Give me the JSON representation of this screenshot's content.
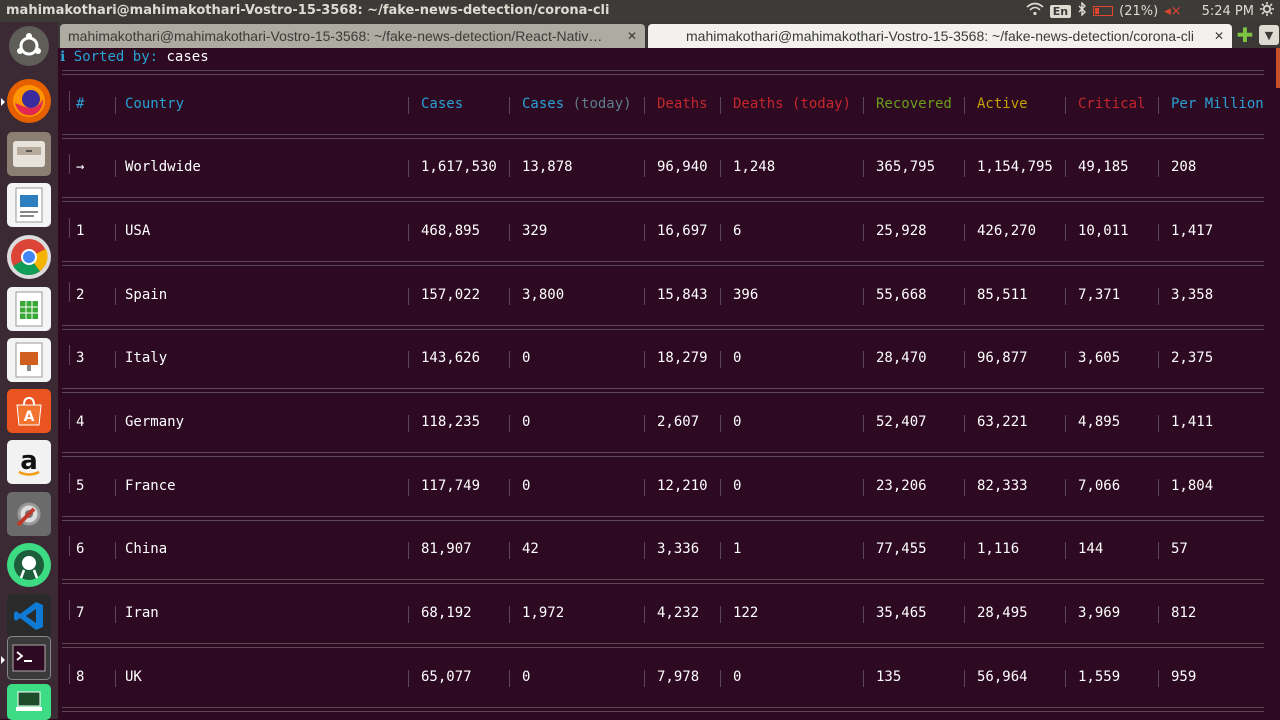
{
  "topbar": {
    "title": "mahimakothari@mahimakothari-Vostro-15-3568: ~/fake-news-detection/corona-cli",
    "keyboard": "En",
    "battery": "(21%)",
    "time": "5:24 PM"
  },
  "launcher": {
    "apps": [
      "ubuntu-dash-icon",
      "firefox-icon",
      "files-icon",
      "writer-icon",
      "chrome-icon",
      "calc-icon",
      "impress-icon",
      "software-center-icon",
      "amazon-icon",
      "system-settings-icon",
      "android-studio-icon",
      "vscode-icon",
      "terminal-icon",
      "vm-icon"
    ]
  },
  "tabs": [
    {
      "label": "mahimakothari@mahimakothari-Vostro-15-3568: ~/fake-news-detection/React-Nativ…",
      "active": false
    },
    {
      "label": "mahimakothari@mahimakothari-Vostro-15-3568: ~/fake-news-detection/corona-cli",
      "active": true
    }
  ],
  "terminal": {
    "info_icon": "ℹ",
    "sorted_label": "Sorted by:",
    "sorted_value": "cases",
    "headers": {
      "num": "#",
      "country": "Country",
      "cases": "Cases",
      "cases_today": "Cases",
      "cases_today_suffix": "(today)",
      "deaths": "Deaths",
      "deaths_today": "Deaths (today)",
      "recovered": "Recovered",
      "active": "Active",
      "critical": "Critical",
      "per_million": "Per Million"
    },
    "rows": [
      {
        "num": "→",
        "country": "Worldwide",
        "cases": "1,617,530",
        "cases_today": "13,878",
        "deaths": "96,940",
        "deaths_today": "1,248",
        "recovered": "365,795",
        "active": "1,154,795",
        "critical": "49,185",
        "per_million": "208"
      },
      {
        "num": "1",
        "country": "USA",
        "cases": "468,895",
        "cases_today": "329",
        "deaths": "16,697",
        "deaths_today": "6",
        "recovered": "25,928",
        "active": "426,270",
        "critical": "10,011",
        "per_million": "1,417"
      },
      {
        "num": "2",
        "country": "Spain",
        "cases": "157,022",
        "cases_today": "3,800",
        "deaths": "15,843",
        "deaths_today": "396",
        "recovered": "55,668",
        "active": "85,511",
        "critical": "7,371",
        "per_million": "3,358"
      },
      {
        "num": "3",
        "country": "Italy",
        "cases": "143,626",
        "cases_today": "0",
        "deaths": "18,279",
        "deaths_today": "0",
        "recovered": "28,470",
        "active": "96,877",
        "critical": "3,605",
        "per_million": "2,375"
      },
      {
        "num": "4",
        "country": "Germany",
        "cases": "118,235",
        "cases_today": "0",
        "deaths": "2,607",
        "deaths_today": "0",
        "recovered": "52,407",
        "active": "63,221",
        "critical": "4,895",
        "per_million": "1,411"
      },
      {
        "num": "5",
        "country": "France",
        "cases": "117,749",
        "cases_today": "0",
        "deaths": "12,210",
        "deaths_today": "0",
        "recovered": "23,206",
        "active": "82,333",
        "critical": "7,066",
        "per_million": "1,804"
      },
      {
        "num": "6",
        "country": "China",
        "cases": "81,907",
        "cases_today": "42",
        "deaths": "3,336",
        "deaths_today": "1",
        "recovered": "77,455",
        "active": "1,116",
        "critical": "144",
        "per_million": "57"
      },
      {
        "num": "7",
        "country": "Iran",
        "cases": "68,192",
        "cases_today": "1,972",
        "deaths": "4,232",
        "deaths_today": "122",
        "recovered": "35,465",
        "active": "28,495",
        "critical": "3,969",
        "per_million": "812"
      },
      {
        "num": "8",
        "country": "UK",
        "cases": "65,077",
        "cases_today": "0",
        "deaths": "7,978",
        "deaths_today": "0",
        "recovered": "135",
        "active": "56,964",
        "critical": "1,559",
        "per_million": "959"
      }
    ]
  }
}
